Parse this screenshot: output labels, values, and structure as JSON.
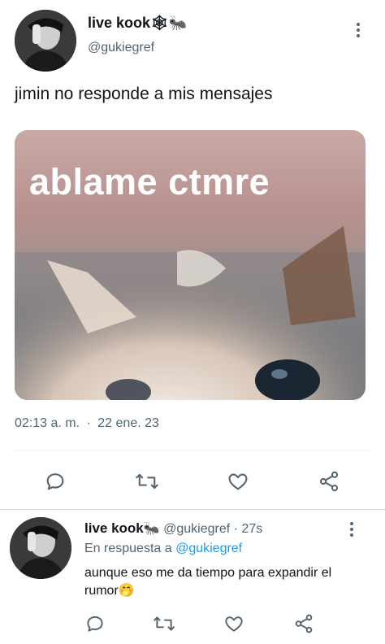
{
  "tweet": {
    "author_name": "live kook",
    "author_emoji": "🕸🐜",
    "author_handle": "@gukiegref",
    "text": "jimin no responde a mis mensajes",
    "image_caption": "ablame ctmre",
    "timestamp": "02:13 a. m.",
    "separator": "·",
    "date": "22 ene. 23"
  },
  "actions": {
    "reply": "reply-icon",
    "retweet": "retweet-icon",
    "like": "heart-icon",
    "share": "share-icon"
  },
  "reply": {
    "author_name": "live kook",
    "author_emoji": "🐜",
    "author_handle": "@gukiegref",
    "age": "· 27s",
    "context_prefix": "En respuesta a",
    "context_handle": "@gukiegref",
    "text": "aunque eso me da tiempo para expandir el rumor",
    "text_emoji": "🤭"
  },
  "colors": {
    "text": "#0f1419",
    "secondary": "#536471",
    "accent": "#1d9bf0"
  }
}
